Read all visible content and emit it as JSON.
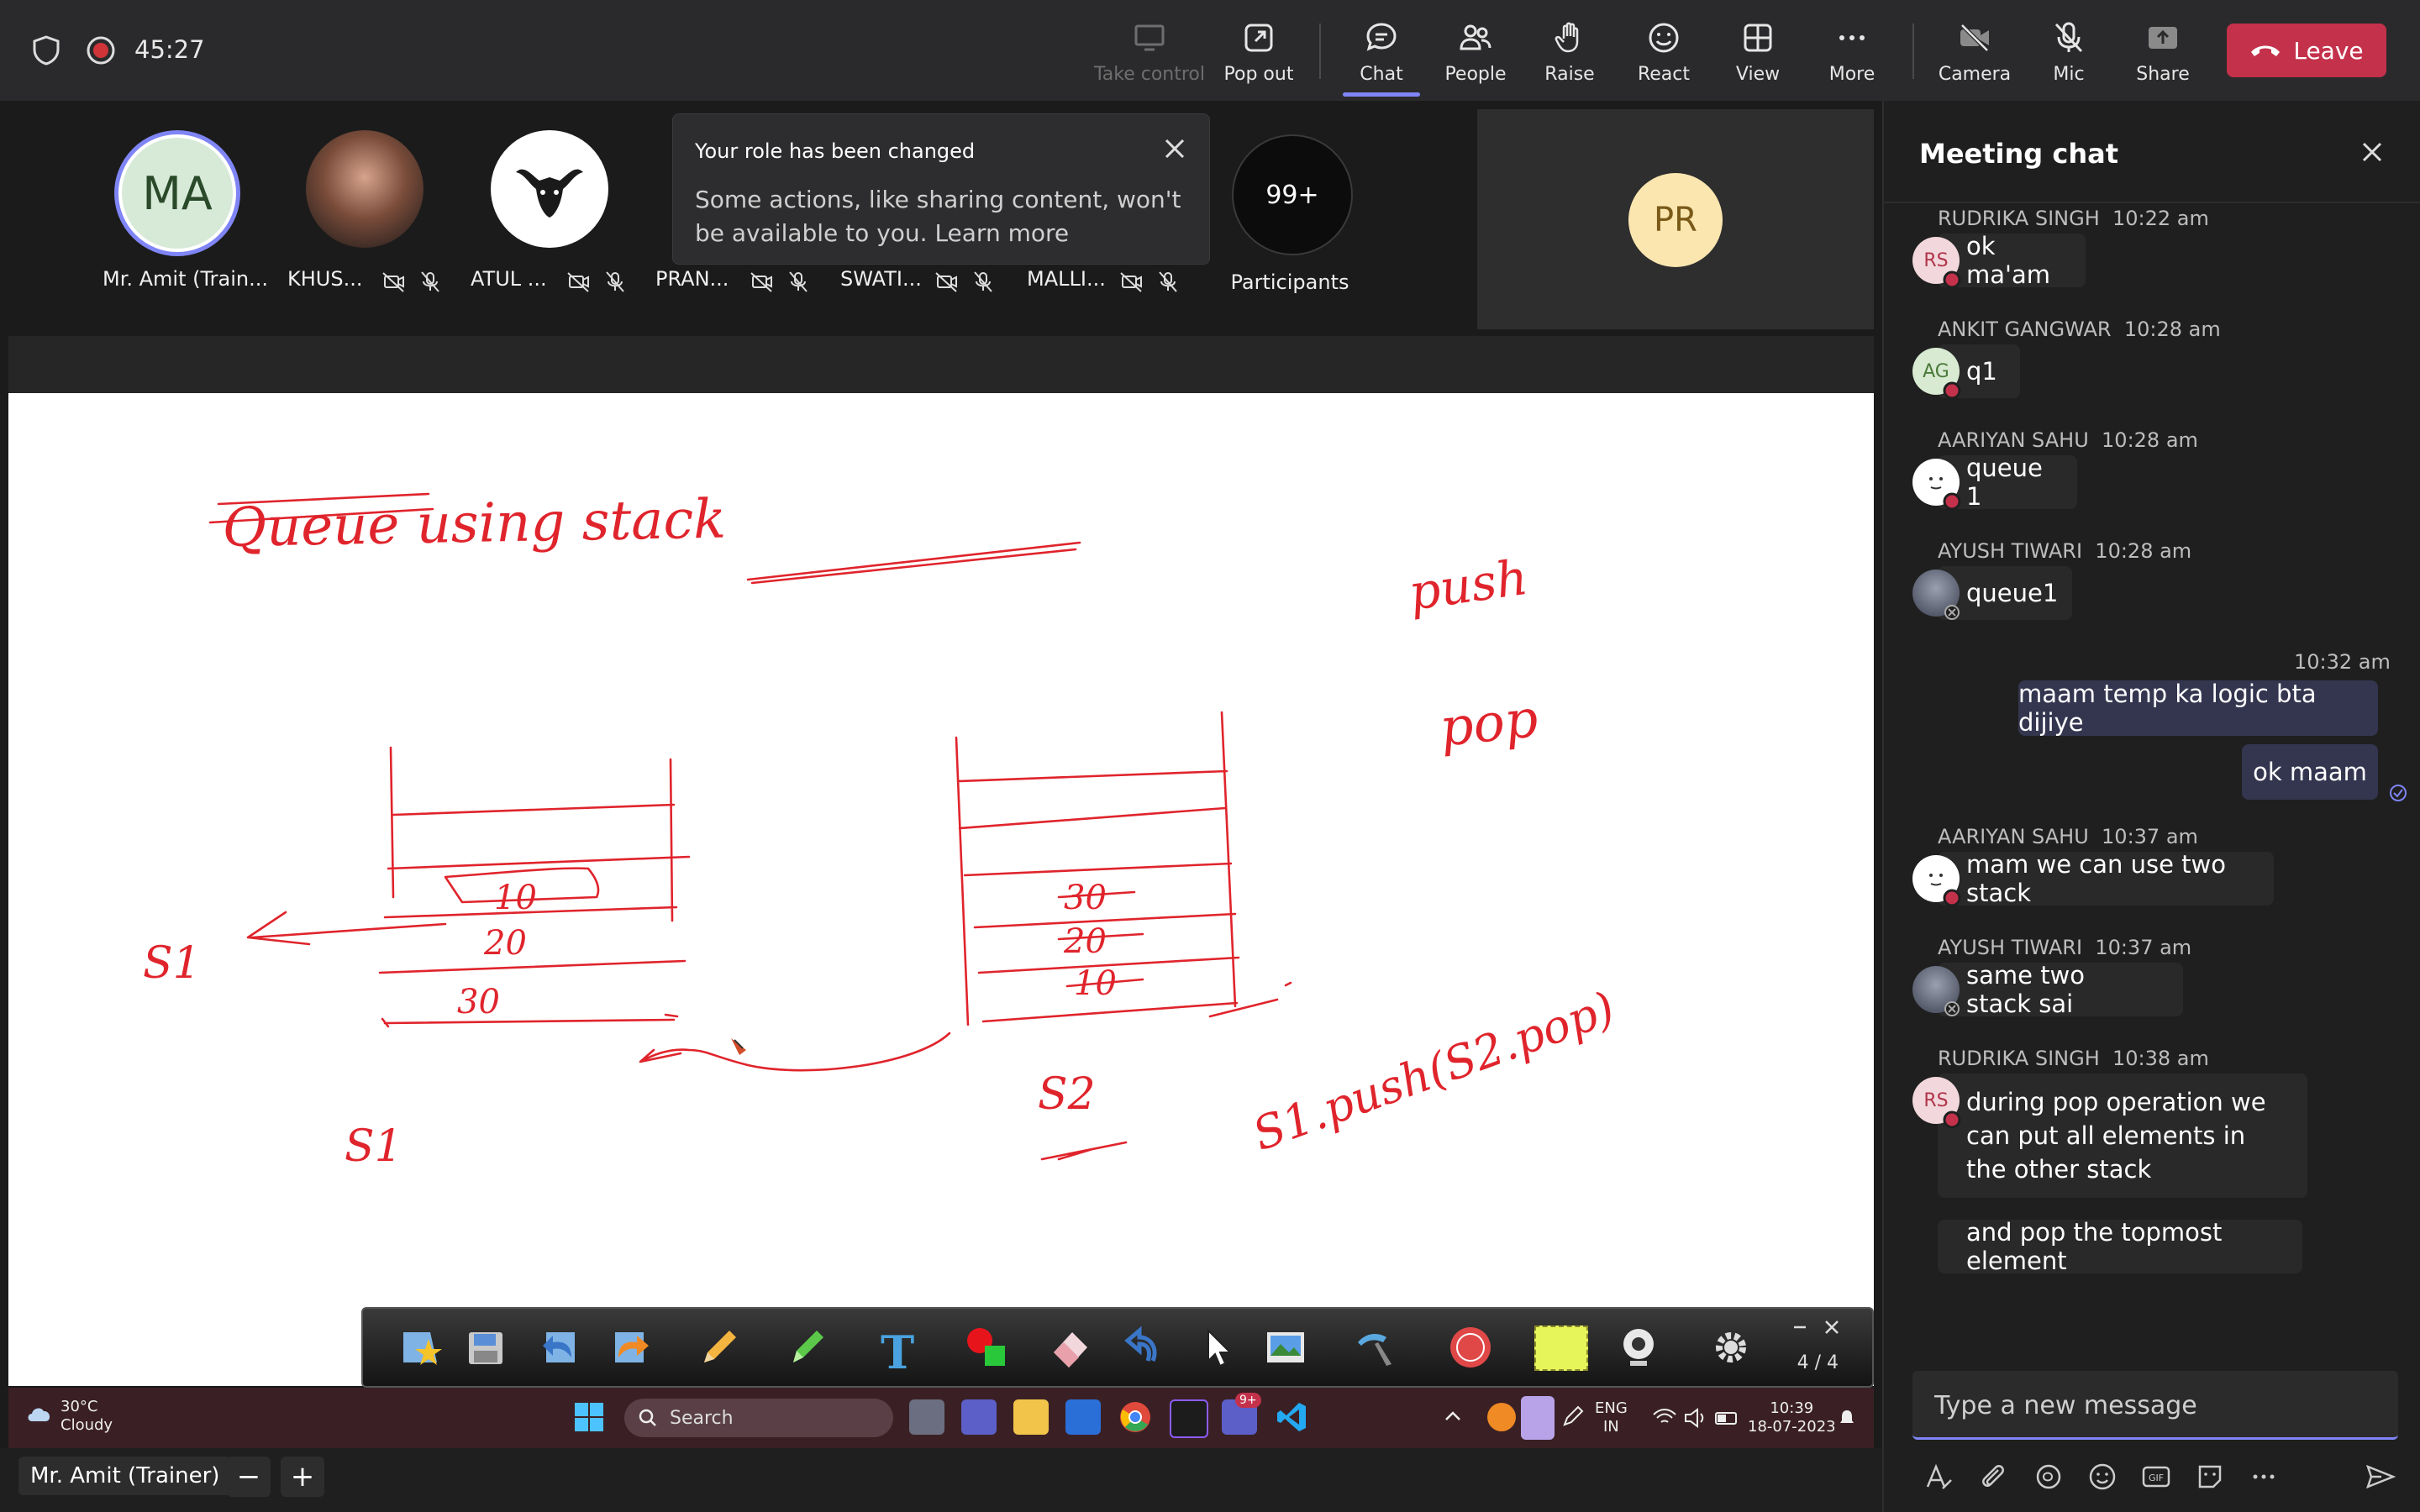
{
  "topbar": {
    "timer": "45:27",
    "buttons": {
      "take_control": "Take control",
      "pop_out": "Pop out",
      "chat": "Chat",
      "people": "People",
      "raise": "Raise",
      "react": "React",
      "view": "View",
      "more": "More",
      "camera": "Camera",
      "mic": "Mic",
      "share": "Share"
    },
    "leave": "Leave"
  },
  "participants": [
    {
      "initials": "MA",
      "name": "Mr. Amit (Train..."
    },
    {
      "name": "KHUS..."
    },
    {
      "name": "ATUL ..."
    },
    {
      "name": "PRAN..."
    },
    {
      "name": "SWATI..."
    },
    {
      "name": "MALLI..."
    }
  ],
  "participant_count": "99+",
  "participant_count_label": "Participants",
  "pr_tile_initials": "PR",
  "toast": {
    "title": "Your role has been changed",
    "body": "Some actions, like sharing content, won't be available to you. Learn more"
  },
  "whiteboard": {
    "title": "Queue using stack",
    "labels": [
      "push",
      "pop",
      "S1",
      "S2",
      "S1",
      "S1.push(S2.pop)"
    ],
    "stack1_values": [
      "10",
      "20",
      "30"
    ],
    "stack2_values": [
      "30",
      "20",
      "10"
    ]
  },
  "pen_toolbar": {
    "page": "4 / 4"
  },
  "taskbar": {
    "weather_temp": "30°C",
    "weather_desc": "Cloudy",
    "search": "Search",
    "notif_badge": "9+",
    "lang1": "ENG",
    "lang2": "IN",
    "time": "10:39",
    "date": "18-07-2023"
  },
  "presenter_name": "Mr. Amit (Trainer)",
  "chat": {
    "title": "Meeting chat",
    "messages": [
      {
        "initials": "RS",
        "author": "RUDRIKA SINGH",
        "time": "10:22 am",
        "text": "ok ma'am"
      },
      {
        "initials": "AG",
        "author": "ANKIT GANGWAR",
        "time": "10:28 am",
        "text": "q1"
      },
      {
        "author": "AARIYAN SAHU",
        "time": "10:28 am",
        "text": "queue 1"
      },
      {
        "author": "AYUSH TIWARI",
        "time": "10:28 am",
        "text": "queue1"
      },
      {
        "mine": true,
        "time": "10:32 am",
        "text": "maam temp ka logic bta dijiye"
      },
      {
        "mine": true,
        "text": "ok maam"
      },
      {
        "author": "AARIYAN SAHU",
        "time": "10:37 am",
        "text": "mam we can use two stack"
      },
      {
        "author": "AYUSH TIWARI",
        "time": "10:37 am",
        "text": "same two stack sai"
      },
      {
        "initials": "RS",
        "author": "RUDRIKA SINGH",
        "time": "10:38 am",
        "text": "during pop operation we can put all elements in the other stack",
        "text2": "and pop the topmost element"
      }
    ],
    "compose_placeholder": "Type a new message"
  },
  "colors": {
    "accent": "#7f85f5",
    "leave": "#c4314b",
    "ink": "#e0242c"
  }
}
